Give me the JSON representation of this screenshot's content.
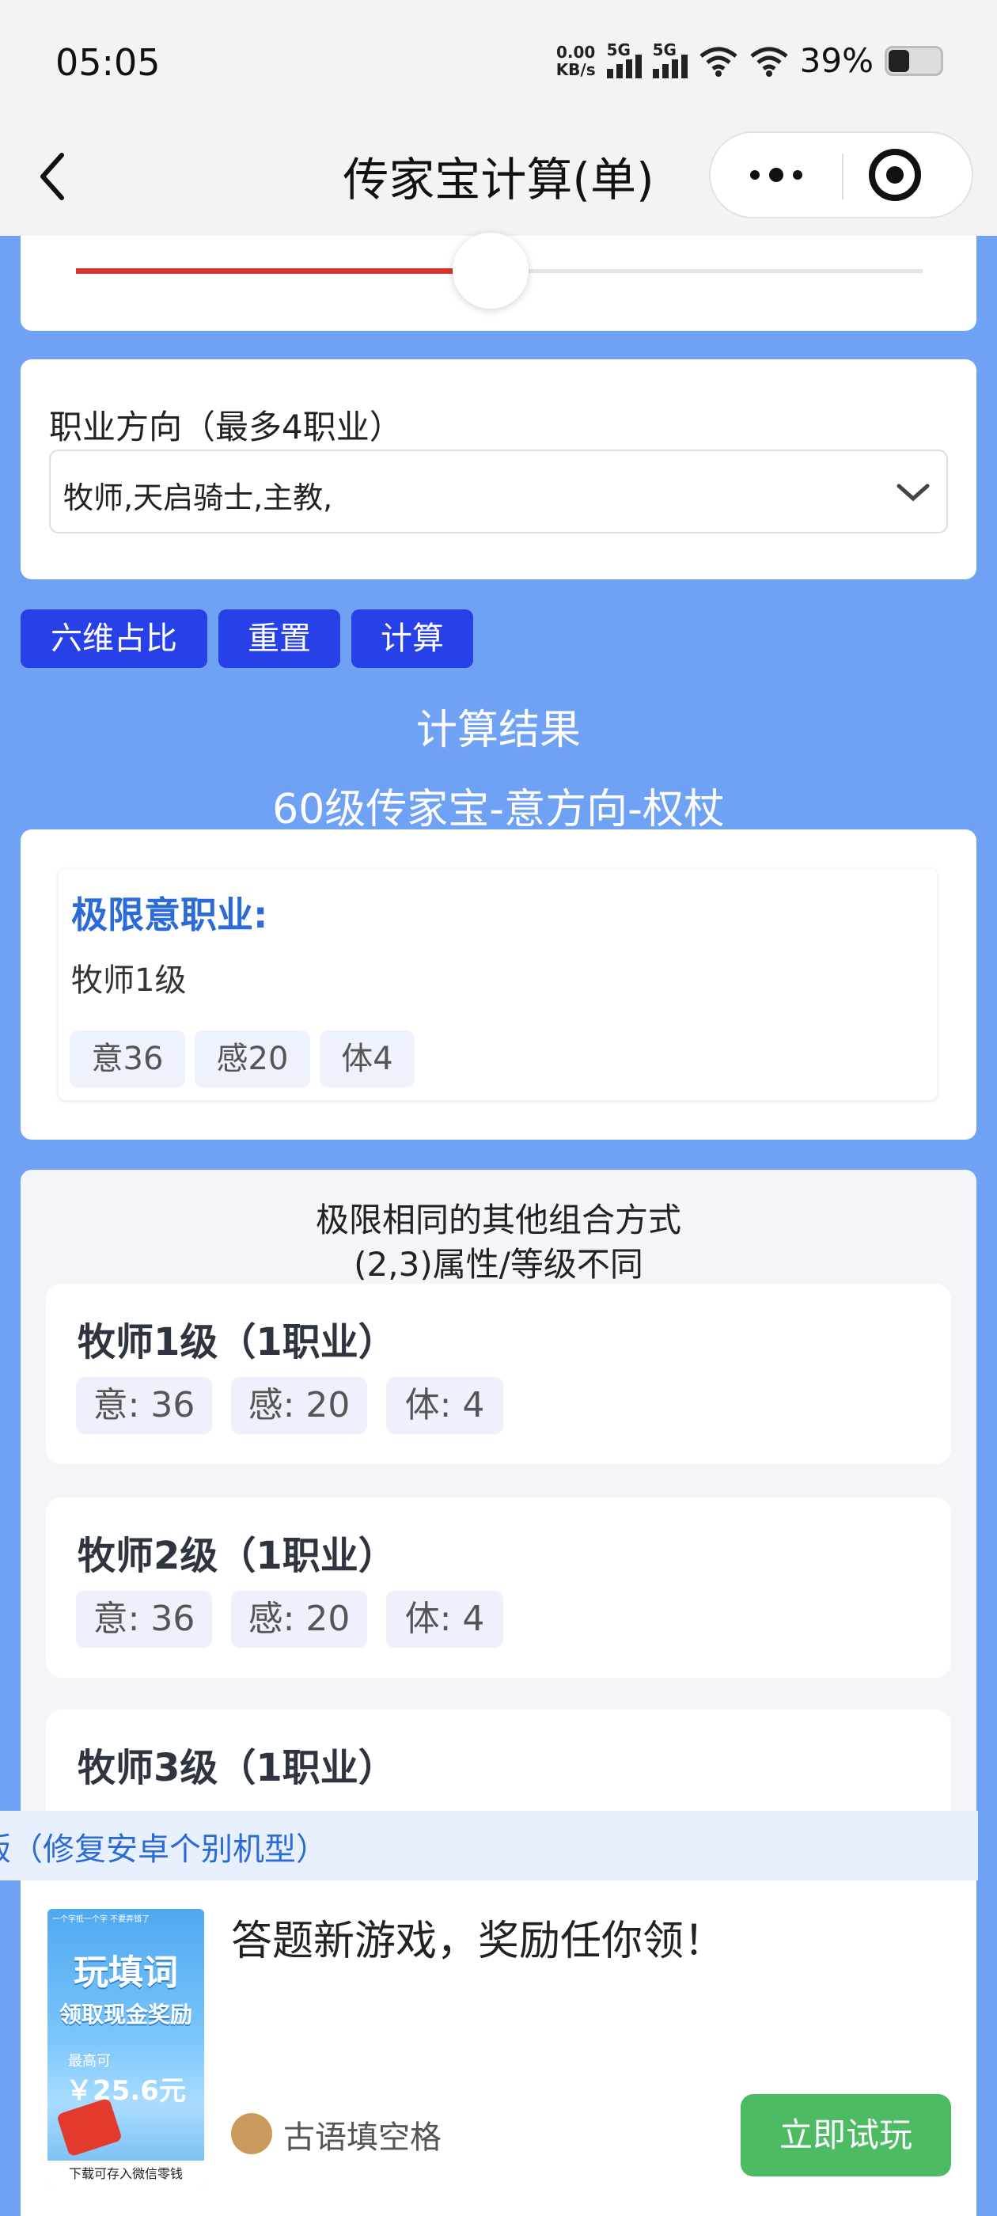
{
  "status_bar": {
    "time": "05:05",
    "net_speed_value": "0.00",
    "net_speed_unit": "KB/s",
    "sim1": "5G",
    "sim2": "5G",
    "battery": "39%",
    "battery_level": 0.39
  },
  "nav": {
    "title": "传家宝计算(单)"
  },
  "slider": {
    "value_fraction": 0.49,
    "fill_color": "#d9352c"
  },
  "job": {
    "label": "职业方向（最多4职业）",
    "value": "牧师,天启骑士,主教,"
  },
  "buttons": {
    "ratio": "六维占比",
    "reset": "重置",
    "calc": "计算"
  },
  "result": {
    "heading": "计算结果",
    "subheading": "60级传家宝-意方向-权杖"
  },
  "limit": {
    "title": "极限意职业:",
    "job": "牧师1级",
    "stats": [
      "意36",
      "感20",
      "体4"
    ]
  },
  "combos": {
    "heading_line1": "极限相同的其他组合方式",
    "heading_line2": "(2,3)属性/等级不同",
    "items": [
      {
        "name": "牧师1级（1职业）",
        "stats": [
          "意: 36",
          "感: 20",
          "体: 4"
        ]
      },
      {
        "name": "牧师2级（1职业）",
        "stats": [
          "意: 36",
          "感: 20",
          "体: 4"
        ]
      },
      {
        "name": "牧师3级（1职业）",
        "stats": []
      }
    ]
  },
  "notice": {
    "text": "版（修复安卓个别机型）"
  },
  "ad": {
    "image_text_top": "一个字抵一个字 不要弄错了",
    "image_text_main": "玩填词",
    "image_text_sub": "领取现金奖励",
    "image_text_max": "最高可",
    "image_text_amount": "￥25.6元",
    "image_text_bottom": "下载可存入微信零钱",
    "title": "答题新游戏，奖励任你领！",
    "source": "古语填空格",
    "cta": "立即试玩",
    "cta_color": "#4cbb64"
  },
  "colors": {
    "page_bg": "#6fa2f5",
    "primary_button": "#2840e8",
    "accent_text": "#2b6bd8"
  }
}
